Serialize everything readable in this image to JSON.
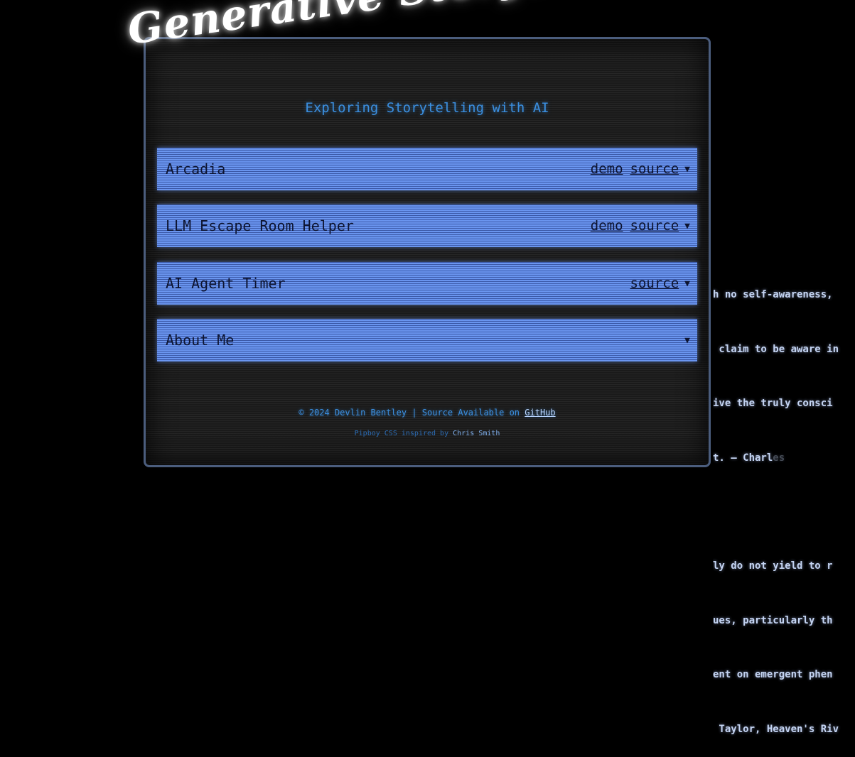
{
  "header": {
    "title": "Generative Storytelling",
    "subtitle": "Exploring Storytelling with AI"
  },
  "projects": [
    {
      "title": "Arcadia",
      "demo": "demo",
      "source": "source",
      "toggle": "▼"
    },
    {
      "title": "LLM Escape Room Helper",
      "demo": "demo",
      "source": "source",
      "toggle": "▼"
    },
    {
      "title": "AI Agent Timer",
      "source": "source",
      "toggle": "▼"
    },
    {
      "title": "About Me",
      "toggle": "▼"
    }
  ],
  "footer": {
    "copyright": "© 2024 Devlin Bentley | Source Available on ",
    "github_link": "GitHub",
    "credit_prefix": "Pipboy CSS inspired by ",
    "credit_name": "Chris Smith"
  },
  "background_text": {
    "lines": [
      "h no self-awareness,",
      " claim to be aware in",
      "ive the truly consci",
      "t. — Charl",
      "ly do not yield to r",
      "ues, particularly th",
      "ent on emergent phen",
      " Taylor, Heaven's Riv"
    ],
    "faded_tail": "es"
  },
  "colors": {
    "accent": "#3b8fe0",
    "card": "#6a95ef",
    "panel_border": "#4b5d7d"
  }
}
